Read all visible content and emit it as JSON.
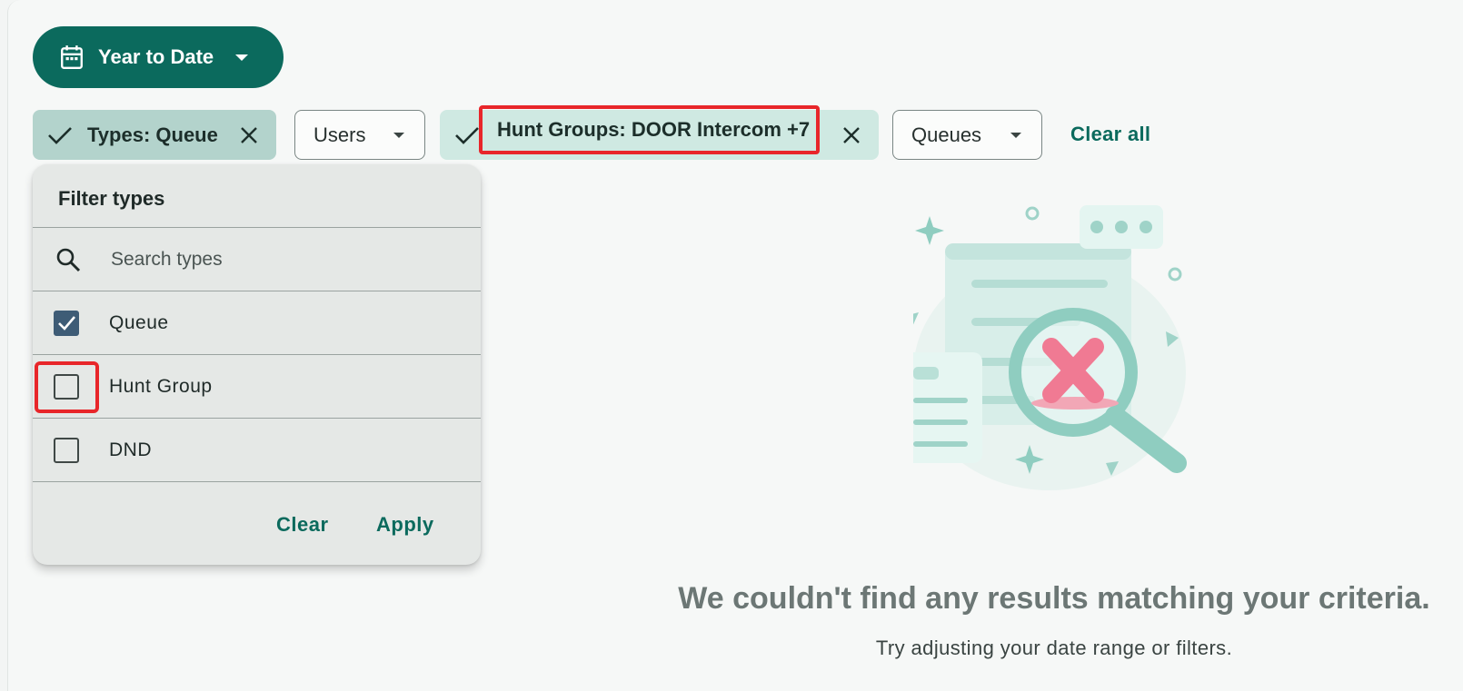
{
  "date_range": {
    "label": "Year to Date",
    "icon": "calendar-icon"
  },
  "filters": {
    "types_chip": {
      "label": "Types: Queue",
      "selected": true
    },
    "users_chip": {
      "label": "Users"
    },
    "hunt_groups_chip": {
      "label": "Hunt Groups: DOOR Intercom +7",
      "selected": true
    },
    "queues_chip": {
      "label": "Queues"
    },
    "clear_all": "Clear all"
  },
  "filter_panel": {
    "title": "Filter types",
    "search_placeholder": "Search types",
    "options": [
      {
        "label": "Queue",
        "checked": true
      },
      {
        "label": "Hunt Group",
        "checked": false
      },
      {
        "label": "DND",
        "checked": false
      }
    ],
    "clear_label": "Clear",
    "apply_label": "Apply"
  },
  "empty_state": {
    "title": "We couldn't find any results matching your criteria.",
    "subtitle": "Try adjusting your date range or filters."
  },
  "colors": {
    "primary": "#0b6a5d",
    "highlight": "#e8262a",
    "chip_selected": "#b3d3cc",
    "checkbox_checked": "#3e5c76"
  }
}
